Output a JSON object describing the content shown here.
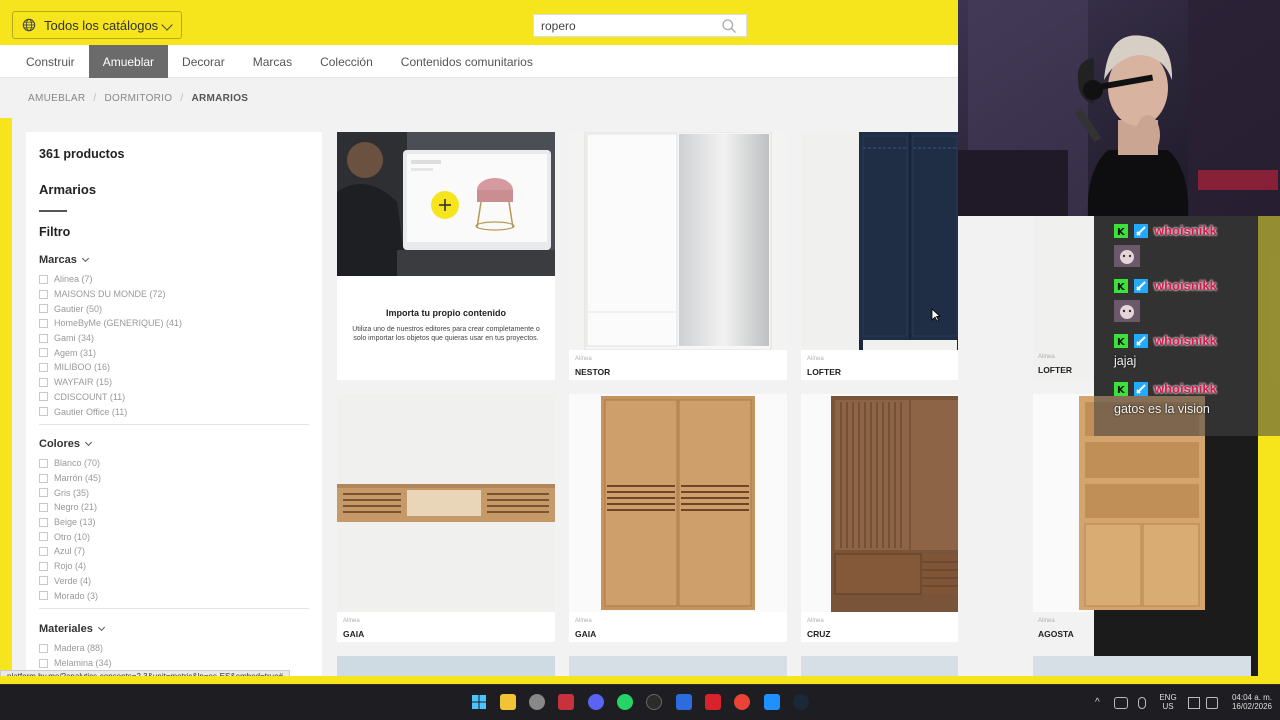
{
  "topbar": {
    "catalog_label": "Todos los catálogos",
    "search_value": "ropero"
  },
  "nav": {
    "tabs": [
      {
        "label": "Construir",
        "active": false
      },
      {
        "label": "Amueblar",
        "active": true
      },
      {
        "label": "Decorar",
        "active": false
      },
      {
        "label": "Marcas",
        "active": false
      },
      {
        "label": "Colección",
        "active": false
      },
      {
        "label": "Contenidos comunitarios",
        "active": false
      }
    ]
  },
  "breadcrumb": [
    "AMUEBLAR",
    "DORMITORIO",
    "ARMARIOS"
  ],
  "sidebar": {
    "count": "361 productos",
    "category_title": "Armarios",
    "filter_title": "Filtro",
    "groups": [
      {
        "title": "Marcas",
        "options": [
          "Alinea (7)",
          "MAISONS DU MONDE (72)",
          "Gautier (50)",
          "HomeByMe (GENERIQUE) (41)",
          "Gami (34)",
          "Agem (31)",
          "MILIBOO (16)",
          "WAYFAIR (15)",
          "CDISCOUNT (11)",
          "Gautier Office (11)"
        ]
      },
      {
        "title": "Colores",
        "options": [
          "Blanco (70)",
          "Marrón (45)",
          "Gris (35)",
          "Negro (21)",
          "Beige (13)",
          "Otro (10)",
          "Azul (7)",
          "Rojo (4)",
          "Verde (4)",
          "Morado (3)"
        ]
      },
      {
        "title": "Materiales",
        "options": [
          "Madera (88)",
          "Melamina (34)"
        ]
      }
    ]
  },
  "promo": {
    "title": "Importa tu propio contenido",
    "text": "Utiliza uno de nuestros editores para crear completamente o solo importar los objetos que quieras usar en tus proyectos."
  },
  "products": [
    {
      "brand": "Alinea",
      "name": "NESTOR"
    },
    {
      "brand": "Alinea",
      "name": "LOFTER"
    },
    {
      "brand": "Alinea",
      "name": "LOFTER"
    },
    {
      "brand": "Alinea",
      "name": "GAIA"
    },
    {
      "brand": "Alinea",
      "name": "GAIA"
    },
    {
      "brand": "Alinea",
      "name": "CRUZ"
    },
    {
      "brand": "Alinea",
      "name": "AGOSTA"
    }
  ],
  "status_url": "platform.by.me/?analytics-consents=2,3&unit=metric&ln=es-ES&embed=true#",
  "chat": {
    "messages": [
      {
        "user": "whoisnikk",
        "text": "",
        "emote": true
      },
      {
        "user": "whoisnikk",
        "text": "",
        "emote": true
      },
      {
        "user": "whoisnikk",
        "text": "jajaj",
        "emote": false
      },
      {
        "user": "whoisnikk",
        "text": "gatos es la vision",
        "emote": false
      }
    ]
  },
  "taskbar": {
    "lang": "ENG",
    "region": "US",
    "time": "04:04 a. m.",
    "date": "16/02/2026"
  },
  "colors": {
    "brand_yellow": "#f6e51c",
    "active_tab": "#6b6b6b",
    "chat_username": "#d9174d"
  }
}
